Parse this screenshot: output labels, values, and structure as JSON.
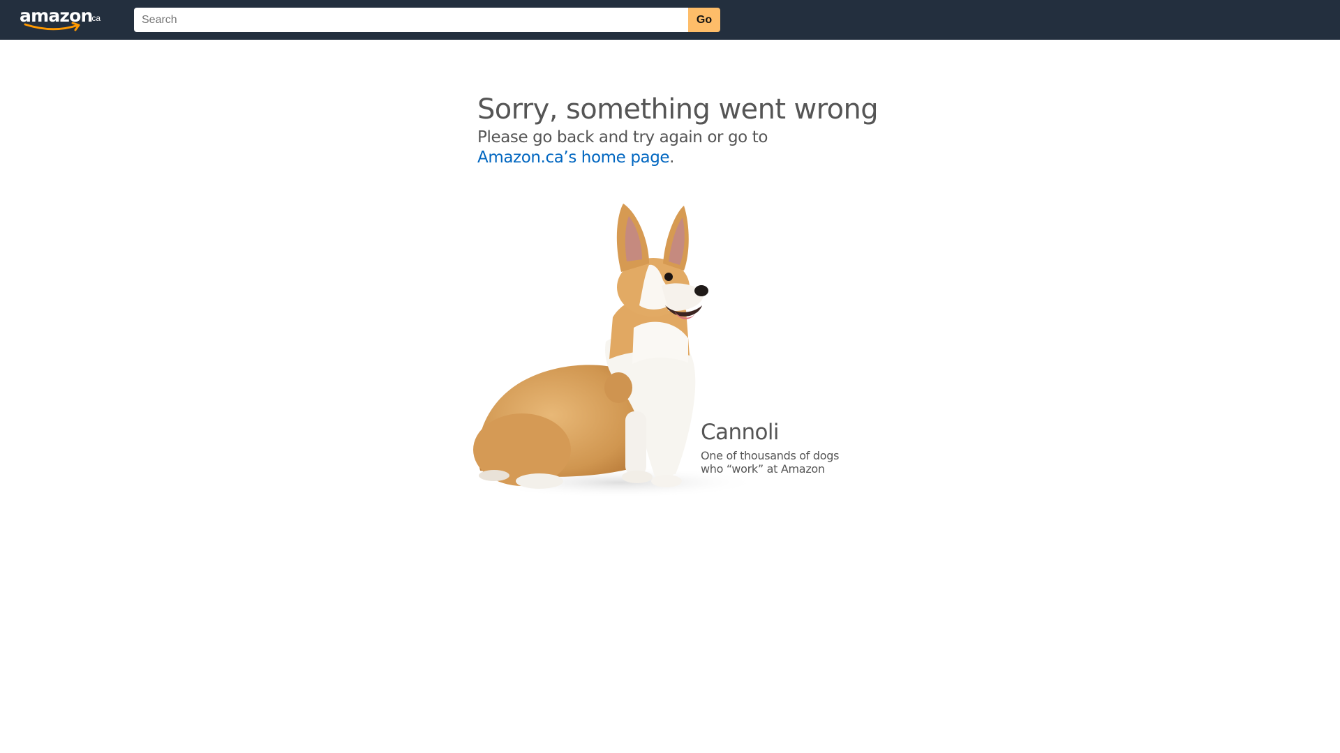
{
  "header": {
    "logo_text": "amazon",
    "logo_tld": ".ca",
    "search_placeholder": "Search",
    "search_value": "",
    "go_label": "Go",
    "bar_color": "#232f3e",
    "go_color": "#febd69"
  },
  "error": {
    "title": "Sorry, something went wrong",
    "subtitle": "Please go back and try again or go to",
    "link_text": "Amazon.ca’s home page",
    "link_suffix": ".",
    "link_color": "#0066c0"
  },
  "dog": {
    "name": "Cannoli",
    "caption_line1": "One of thousands of dogs",
    "caption_line2": "who “work” at Amazon"
  }
}
